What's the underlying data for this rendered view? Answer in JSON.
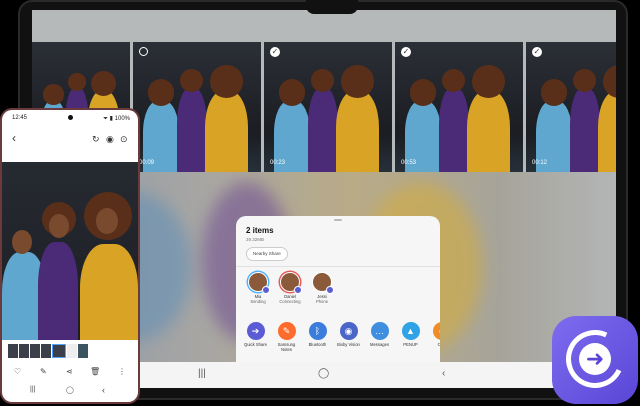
{
  "tablet": {
    "thumbnails": [
      {
        "selected": false,
        "has_selector": false,
        "duration": ""
      },
      {
        "selected": false,
        "has_selector": true,
        "duration": "00:09"
      },
      {
        "selected": true,
        "has_selector": true,
        "duration": "00:23"
      },
      {
        "selected": true,
        "has_selector": true,
        "duration": "00:53"
      },
      {
        "selected": true,
        "has_selector": true,
        "duration": "00:12"
      },
      {
        "selected": false,
        "has_selector": false,
        "duration": ""
      }
    ]
  },
  "share_sheet": {
    "title": "2 items",
    "size": "29.32MB",
    "nearby_share": "Nearby Share",
    "contacts": [
      {
        "name": "Mia",
        "status": "Sending"
      },
      {
        "name": "Daniel",
        "status": "Connecting"
      },
      {
        "name": "Jessi",
        "status": "Phone"
      }
    ],
    "apps": [
      {
        "label": "Quick Share",
        "icon": "quick-share-icon",
        "color": "#5b5bd6",
        "glyph": "➔"
      },
      {
        "label": "Samsung Notes",
        "icon": "notes-icon",
        "color": "#ff6b2c",
        "glyph": "✎"
      },
      {
        "label": "Bluetooth",
        "icon": "bluetooth-icon",
        "color": "#3b7ddd",
        "glyph": "ᛒ"
      },
      {
        "label": "Bixby Vision",
        "icon": "eye-icon",
        "color": "#4a66c9",
        "glyph": "◉"
      },
      {
        "label": "Messages",
        "icon": "messages-icon",
        "color": "#3f8ee0",
        "glyph": "…"
      },
      {
        "label": "PENUP",
        "icon": "penup-icon",
        "color": "#2fa3e6",
        "glyph": "▲"
      },
      {
        "label": "Con",
        "icon": "contacts-icon",
        "color": "#f28c28",
        "glyph": "●"
      }
    ]
  },
  "phone": {
    "time": "12:45",
    "battery": "100%",
    "status_icons": "⏷ ▮ 100%"
  },
  "icons": {
    "back": "‹",
    "tablet_nav": [
      "|||",
      "◯",
      "‹"
    ],
    "phone_nav": [
      "|||",
      "◯",
      "‹"
    ],
    "phone_actions": [
      "♡",
      "✎",
      "⋖",
      "🗑",
      "⋮"
    ],
    "phone_toolbar": [
      "↻",
      "◉",
      "⊙"
    ]
  }
}
